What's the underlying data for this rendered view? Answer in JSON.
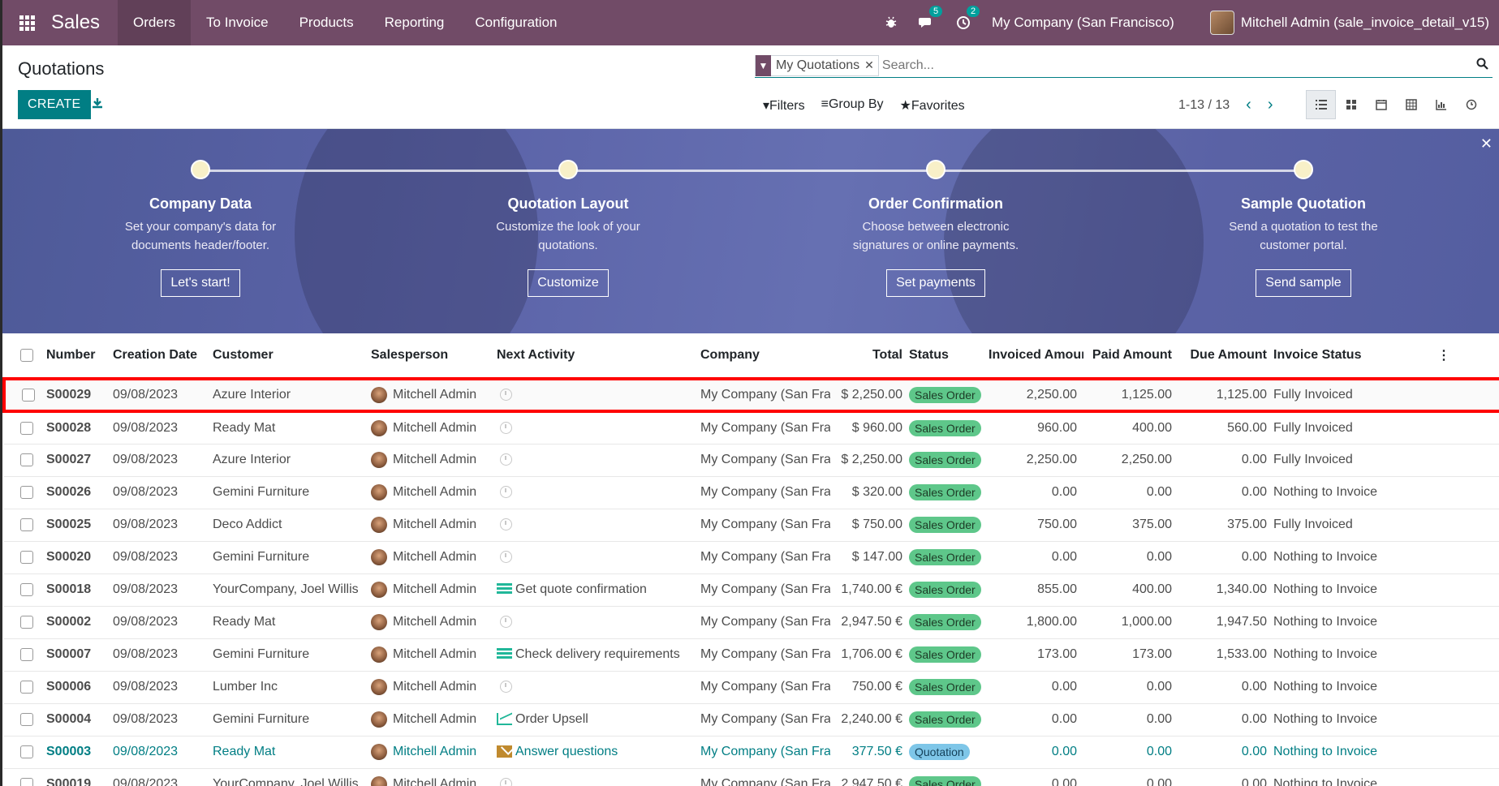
{
  "navbar": {
    "brand": "Sales",
    "menu": [
      "Orders",
      "To Invoice",
      "Products",
      "Reporting",
      "Configuration"
    ],
    "messages_count": "5",
    "activities_count": "2",
    "company": "My Company (San Francisco)",
    "user": "Mitchell Admin (sale_invoice_detail_v15)"
  },
  "control_panel": {
    "title": "Quotations",
    "create_label": "CREATE",
    "facet_label": "My Quotations",
    "search_placeholder": "Search...",
    "filters_label": "Filters",
    "groupby_label": "Group By",
    "favorites_label": "Favorites",
    "pager": "1-13 / 13"
  },
  "banner": {
    "steps": [
      {
        "title": "Company Data",
        "desc1": "Set your company's data for",
        "desc2": "documents header/footer.",
        "button": "Let's start!"
      },
      {
        "title": "Quotation Layout",
        "desc1": "Customize the look of your",
        "desc2": "quotations.",
        "button": "Customize"
      },
      {
        "title": "Order Confirmation",
        "desc1": "Choose between electronic",
        "desc2": "signatures or online payments.",
        "button": "Set payments"
      },
      {
        "title": "Sample Quotation",
        "desc1": "Send a quotation to test the",
        "desc2": "customer portal.",
        "button": "Send sample"
      }
    ]
  },
  "table": {
    "columns": [
      "Number",
      "Creation Date",
      "Customer",
      "Salesperson",
      "Next Activity",
      "Company",
      "Total",
      "Status",
      "Invoiced Amount",
      "Paid Amount",
      "Due Amount",
      "Invoice Status"
    ],
    "rows": [
      {
        "number": "S00029",
        "date": "09/08/2023",
        "customer": "Azure Interior",
        "salesperson": "Mitchell Admin",
        "activity": "",
        "activity_icon": "clock",
        "company": "My Company (San Francisco)",
        "total": "$ 2,250.00",
        "status": "Sales Order",
        "invoiced": "2,250.00",
        "paid": "1,125.00",
        "due": "1,125.00",
        "invoice_status": "Fully Invoiced"
      },
      {
        "number": "S00028",
        "date": "09/08/2023",
        "customer": "Ready Mat",
        "salesperson": "Mitchell Admin",
        "activity": "",
        "activity_icon": "clock",
        "company": "My Company (San Francisco)",
        "total": "$ 960.00",
        "status": "Sales Order",
        "invoiced": "960.00",
        "paid": "400.00",
        "due": "560.00",
        "invoice_status": "Fully Invoiced"
      },
      {
        "number": "S00027",
        "date": "09/08/2023",
        "customer": "Azure Interior",
        "salesperson": "Mitchell Admin",
        "activity": "",
        "activity_icon": "clock",
        "company": "My Company (San Francisco)",
        "total": "$ 2,250.00",
        "status": "Sales Order",
        "invoiced": "2,250.00",
        "paid": "2,250.00",
        "due": "0.00",
        "invoice_status": "Fully Invoiced"
      },
      {
        "number": "S00026",
        "date": "09/08/2023",
        "customer": "Gemini Furniture",
        "salesperson": "Mitchell Admin",
        "activity": "",
        "activity_icon": "clock",
        "company": "My Company (San Francisco)",
        "total": "$ 320.00",
        "status": "Sales Order",
        "invoiced": "0.00",
        "paid": "0.00",
        "due": "0.00",
        "invoice_status": "Nothing to Invoice"
      },
      {
        "number": "S00025",
        "date": "09/08/2023",
        "customer": "Deco Addict",
        "salesperson": "Mitchell Admin",
        "activity": "",
        "activity_icon": "clock",
        "company": "My Company (San Francisco)",
        "total": "$ 750.00",
        "status": "Sales Order",
        "invoiced": "750.00",
        "paid": "375.00",
        "due": "375.00",
        "invoice_status": "Fully Invoiced"
      },
      {
        "number": "S00020",
        "date": "09/08/2023",
        "customer": "Gemini Furniture",
        "salesperson": "Mitchell Admin",
        "activity": "",
        "activity_icon": "clock",
        "company": "My Company (San Francisco)",
        "total": "$ 147.00",
        "status": "Sales Order",
        "invoiced": "0.00",
        "paid": "0.00",
        "due": "0.00",
        "invoice_status": "Nothing to Invoice"
      },
      {
        "number": "S00018",
        "date": "09/08/2023",
        "customer": "YourCompany, Joel Willis",
        "salesperson": "Mitchell Admin",
        "activity": "Get quote confirmation",
        "activity_icon": "todo",
        "company": "My Company (San Francisco)",
        "total": "1,740.00 €",
        "status": "Sales Order",
        "invoiced": "855.00",
        "paid": "400.00",
        "due": "1,340.00",
        "invoice_status": "Nothing to Invoice"
      },
      {
        "number": "S00002",
        "date": "09/08/2023",
        "customer": "Ready Mat",
        "salesperson": "Mitchell Admin",
        "activity": "",
        "activity_icon": "clock",
        "company": "My Company (San Francisco)",
        "total": "2,947.50 €",
        "status": "Sales Order",
        "invoiced": "1,800.00",
        "paid": "1,000.00",
        "due": "1,947.50",
        "invoice_status": "Nothing to Invoice"
      },
      {
        "number": "S00007",
        "date": "09/08/2023",
        "customer": "Gemini Furniture",
        "salesperson": "Mitchell Admin",
        "activity": "Check delivery requirements",
        "activity_icon": "todo",
        "company": "My Company (San Francisco)",
        "total": "1,706.00 €",
        "status": "Sales Order",
        "invoiced": "173.00",
        "paid": "173.00",
        "due": "1,533.00",
        "invoice_status": "Nothing to Invoice"
      },
      {
        "number": "S00006",
        "date": "09/08/2023",
        "customer": "Lumber Inc",
        "salesperson": "Mitchell Admin",
        "activity": "",
        "activity_icon": "clock",
        "company": "My Company (San Francisco)",
        "total": "750.00 €",
        "status": "Sales Order",
        "invoiced": "0.00",
        "paid": "0.00",
        "due": "0.00",
        "invoice_status": "Nothing to Invoice"
      },
      {
        "number": "S00004",
        "date": "09/08/2023",
        "customer": "Gemini Furniture",
        "salesperson": "Mitchell Admin",
        "activity": "Order Upsell",
        "activity_icon": "upsell",
        "company": "My Company (San Francisco)",
        "total": "2,240.00 €",
        "status": "Sales Order",
        "invoiced": "0.00",
        "paid": "0.00",
        "due": "0.00",
        "invoice_status": "Nothing to Invoice"
      },
      {
        "number": "S00003",
        "date": "09/08/2023",
        "customer": "Ready Mat",
        "salesperson": "Mitchell Admin",
        "activity": "Answer questions",
        "activity_icon": "mail",
        "company": "My Company (San Francisco)",
        "total": "377.50 €",
        "status": "Quotation",
        "invoiced": "0.00",
        "paid": "0.00",
        "due": "0.00",
        "invoice_status": "Nothing to Invoice"
      },
      {
        "number": "S00019",
        "date": "09/08/2023",
        "customer": "YourCompany, Joel Willis",
        "salesperson": "Mitchell Admin",
        "activity": "",
        "activity_icon": "clock",
        "company": "My Company (San Francisco)",
        "total": "2,947.50 €",
        "status": "Sales Order",
        "invoiced": "0.00",
        "paid": "0.00",
        "due": "0.00",
        "invoice_status": "Nothing to Invoice"
      }
    ]
  },
  "colors": {
    "navbar": "#714b67",
    "primary": "#017e84",
    "highlight": "#ff0000",
    "status_sales_order": "#5ec78a",
    "status_quotation": "#7ec6e8"
  }
}
